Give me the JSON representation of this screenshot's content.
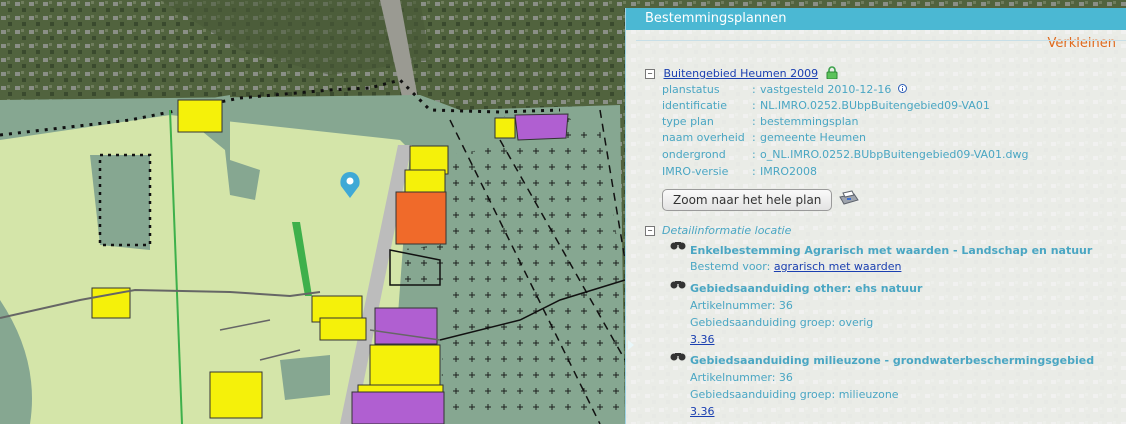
{
  "panel": {
    "title": "Bestemmingsplannen",
    "minimize_label": "Verkleinen",
    "plan": {
      "toggle": "−",
      "name": "Buitengebied Heumen 2009",
      "props": [
        {
          "key": "planstatus",
          "value": "vastgesteld 2010-12-16"
        },
        {
          "key": "identificatie",
          "value": "NL.IMRO.0252.BUbpBuitengebied09-VA01"
        },
        {
          "key": "type plan",
          "value": "bestemmingsplan"
        },
        {
          "key": "naam overheid",
          "value": "gemeente Heumen"
        },
        {
          "key": "ondergrond",
          "value": "o_NL.IMRO.0252.BUbpBuitengebied09-VA01.dwg"
        },
        {
          "key": "IMRO-versie",
          "value": "IMRO2008"
        }
      ],
      "colon": ":",
      "zoom_button": "Zoom naar het hele plan"
    },
    "detail": {
      "toggle": "−",
      "title": "Detailinformatie locatie",
      "item1": {
        "title": "Enkelbestemming Agrarisch met waarden - Landschap en natuur",
        "purpose_label": "Bestemd voor:",
        "purpose_link": "agrarisch met waarden"
      },
      "item2": {
        "title": "Gebiedsaanduiding other: ehs natuur",
        "article": "Artikelnummer: 36",
        "group": "Gebiedsaanduiding groep: overig",
        "link": "3.36"
      },
      "item3": {
        "title": "Gebiedsaanduiding milieuzone - grondwaterbeschermingsgebied",
        "article": "Artikelnummer: 36",
        "group": "Gebiedsaanduiding groep: milieuzone",
        "link": "3.36"
      }
    }
  },
  "colors": {
    "header": "#4bb8d3",
    "accent_orange": "#e06a1d",
    "info_text": "#4aa6c3",
    "link": "#1a3fb0",
    "agri_green": "#d4e5a9",
    "nature_green": "#86a791",
    "yellow": "#f5f10a",
    "purple": "#b05fd1",
    "orange": "#f06a2a"
  }
}
